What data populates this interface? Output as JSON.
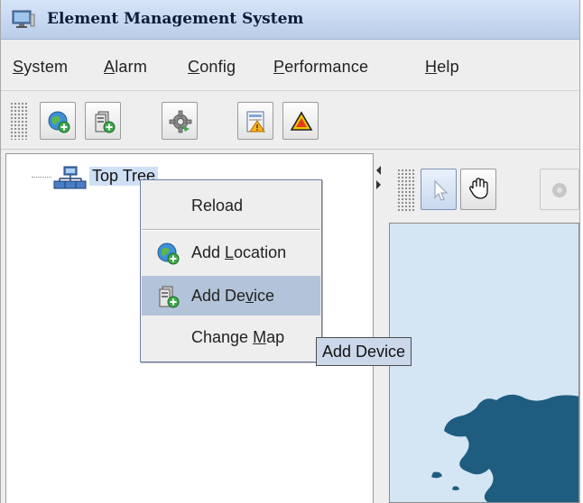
{
  "window": {
    "title": "Element Management System"
  },
  "menubar": {
    "items": [
      {
        "label": "System",
        "mnemonic": "S",
        "rest": "ystem"
      },
      {
        "label": "Alarm",
        "mnemonic": "A",
        "rest": "larm"
      },
      {
        "label": "Config",
        "mnemonic": "C",
        "rest": "onfig"
      },
      {
        "label": "Performance",
        "mnemonic": "P",
        "rest": "erformance"
      },
      {
        "label": "Help",
        "mnemonic": "H",
        "rest": "elp"
      }
    ]
  },
  "toolbar": {
    "buttons": [
      {
        "icon": "add-location-icon"
      },
      {
        "icon": "add-device-icon"
      },
      {
        "icon": "gear-icon"
      },
      {
        "icon": "alarm-report-icon"
      },
      {
        "icon": "warning-triangle-icon"
      }
    ]
  },
  "tree": {
    "root_label": "Top Tree",
    "root_icon": "network-tree-icon"
  },
  "map_toolbar": {
    "tools": [
      {
        "icon": "pointer-arrow-icon"
      },
      {
        "icon": "hand-pan-icon"
      },
      {
        "icon": "gear-disabled-icon"
      }
    ]
  },
  "context_menu": {
    "items": [
      {
        "label": "Reload"
      },
      {
        "pre": "Add ",
        "mnemonic": "L",
        "post": "ocation",
        "label": "Add Location",
        "icon": "add-location-icon"
      },
      {
        "pre": "Add De",
        "mnemonic": "v",
        "post": "ice",
        "label": "Add Device",
        "icon": "add-device-icon",
        "selected": true
      },
      {
        "pre": "Change ",
        "mnemonic": "M",
        "post": "ap",
        "label": "Change Map"
      }
    ]
  },
  "tooltip": {
    "text": "Add Device"
  },
  "colors": {
    "selection": "#b3c3d9",
    "map_sea": "#d4e5f4",
    "map_land": "#1e5d80",
    "tree_selection": "#cfe0f5"
  }
}
